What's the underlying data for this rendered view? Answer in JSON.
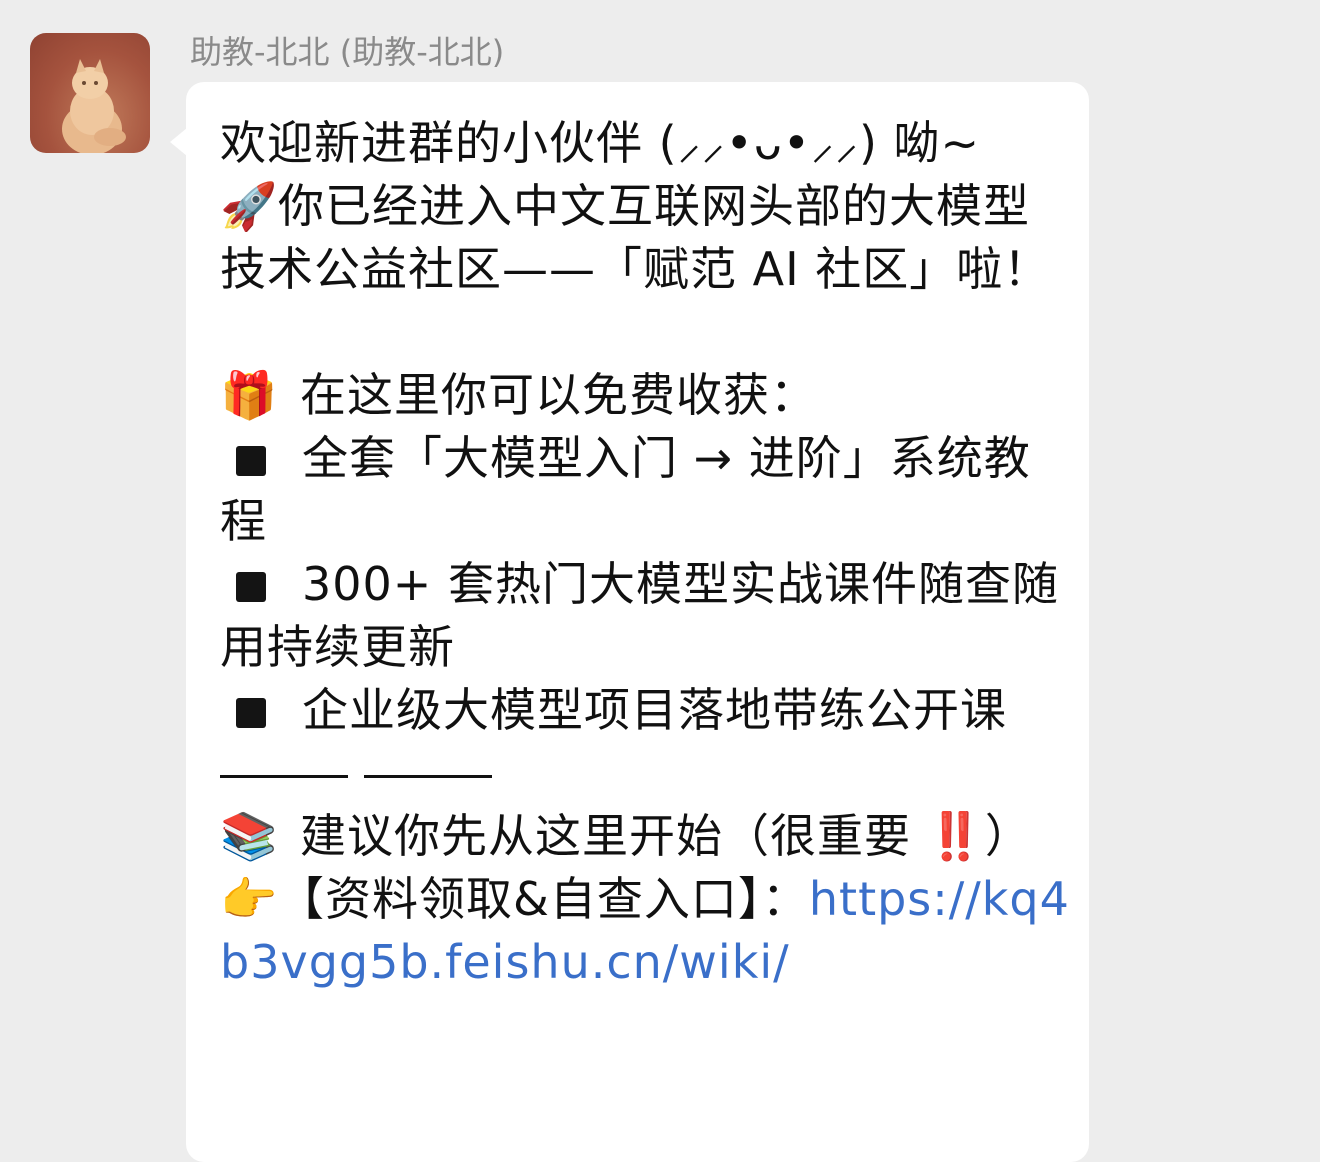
{
  "sender": {
    "name": "助教-北北 (助教-北北)"
  },
  "message": {
    "greeting": "欢迎新进群的小伙伴 (⸝⸝•ᴗ•⸝⸝) 呦~",
    "intro_emoji": "🚀",
    "intro_text": "你已经进入中文互联网头部的大模型技术公益社区——「赋范 AI 社区」啦！",
    "gift_emoji": "🎁",
    "gift_text": "在这里你可以免费收获：",
    "benefits": [
      "全套「大模型入门 → 进阶」系统教程",
      "300+ 套热门大模型实战课件随查随用持续更新",
      "企业级大模型项目落地带练公开课"
    ],
    "books_emoji": "📚",
    "start_text": "建议你先从这里开始（很重要 ‼️）",
    "point_emoji": "👉",
    "entry_label": "【资料领取&自查入口】：",
    "entry_link": "https://kq4b3vgg5b.feishu.cn/wiki/"
  }
}
